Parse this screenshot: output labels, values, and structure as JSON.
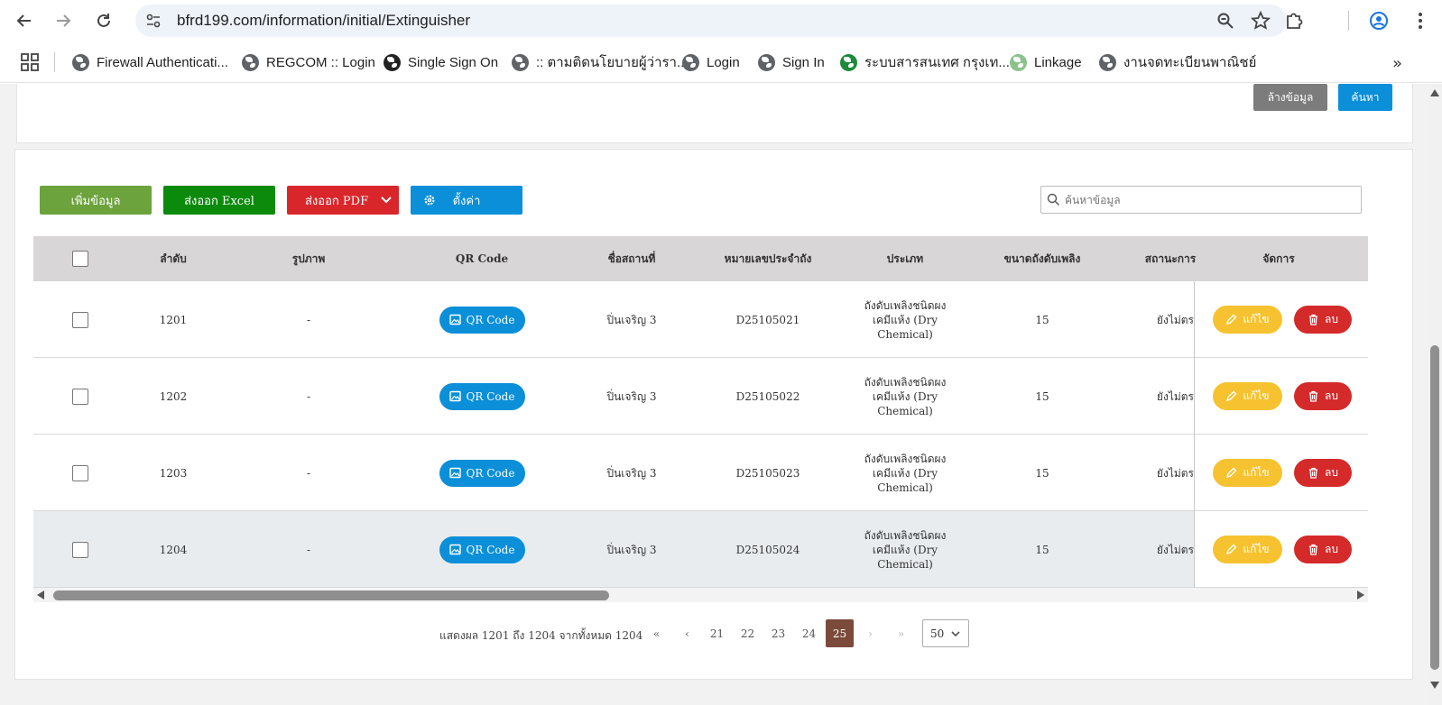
{
  "browser": {
    "url": "bfrd199.com/information/initial/Extinguisher",
    "bookmarks": [
      {
        "label": "Firewall Authenticati...",
        "icon": "globe-icon"
      },
      {
        "label": "REGCOM :: Login",
        "icon": "globe-icon"
      },
      {
        "label": "Single Sign On",
        "icon": "sso-icon"
      },
      {
        "label": ":: ตามติดนโยบายผู้ว่ารา...",
        "icon": "globe-icon"
      },
      {
        "label": "Login",
        "icon": "globe-icon"
      },
      {
        "label": "Sign In",
        "icon": "globe-icon"
      },
      {
        "label": "ระบบสารสนเทศ กรุงเท...",
        "icon": "bma-icon"
      },
      {
        "label": "Linkage",
        "icon": "linkage-icon"
      },
      {
        "label": "งานจดทะเบียนพาณิชย์",
        "icon": "globe-icon"
      }
    ]
  },
  "filter": {
    "clear_label": "ล้างข้อมูล",
    "search_label": "ค้นหา"
  },
  "toolbar": {
    "add_label": "เพิ่มข้อมูล",
    "excel_label": "ส่งออก Excel",
    "pdf_label": "ส่งออก PDF",
    "settings_label": "ตั้งค่า",
    "search_placeholder": "ค้นหาข้อมูล"
  },
  "table": {
    "headers": [
      "ลำดับ",
      "รูปภาพ",
      "QR Code",
      "ชื่อสถานที่",
      "หมายเลขประจำถัง",
      "ประเภท",
      "ขนาดถังดับเพลิง",
      "สถานะการ",
      "จัดการ"
    ],
    "rows": [
      {
        "no": "1201",
        "image": "-",
        "qr": "QR Code",
        "place": "ปิ่นเจริญ 3",
        "tank": "D25105021",
        "type_l1": "ถังดับเพลิงชนิดผง",
        "type_l2": "เคมีแห้ง (Dry",
        "type_l3": "Chemical)",
        "size": "15",
        "status": "ยังไม่ตร",
        "edit": "แก้ไข",
        "del": "ลบ"
      },
      {
        "no": "1202",
        "image": "-",
        "qr": "QR Code",
        "place": "ปิ่นเจริญ 3",
        "tank": "D25105022",
        "type_l1": "ถังดับเพลิงชนิดผง",
        "type_l2": "เคมีแห้ง (Dry",
        "type_l3": "Chemical)",
        "size": "15",
        "status": "ยังไม่ตร",
        "edit": "แก้ไข",
        "del": "ลบ"
      },
      {
        "no": "1203",
        "image": "-",
        "qr": "QR Code",
        "place": "ปิ่นเจริญ 3",
        "tank": "D25105023",
        "type_l1": "ถังดับเพลิงชนิดผง",
        "type_l2": "เคมีแห้ง (Dry",
        "type_l3": "Chemical)",
        "size": "15",
        "status": "ยังไม่ตร",
        "edit": "แก้ไข",
        "del": "ลบ"
      },
      {
        "no": "1204",
        "image": "-",
        "qr": "QR Code",
        "place": "ปิ่นเจริญ 3",
        "tank": "D25105024",
        "type_l1": "ถังดับเพลิงชนิดผง",
        "type_l2": "เคมีแห้ง (Dry",
        "type_l3": "Chemical)",
        "size": "15",
        "status": "ยังไม่ตร",
        "edit": "แก้ไข",
        "del": "ลบ"
      }
    ]
  },
  "pagination": {
    "info": "แสดงผล 1201 ถึง 1204 จากทั้งหมด 1204",
    "first": "«",
    "prev": "‹",
    "pages": [
      "21",
      "22",
      "23",
      "24",
      "25"
    ],
    "active_page": "25",
    "next": "›",
    "last": "»",
    "page_size": "50"
  },
  "colors": {
    "primary": "#0a8fd8",
    "add": "#6ca33c",
    "excel": "#0b8a0b",
    "danger": "#d42a2a",
    "warning": "#f7c22f",
    "active_page": "#7b4a3a"
  }
}
